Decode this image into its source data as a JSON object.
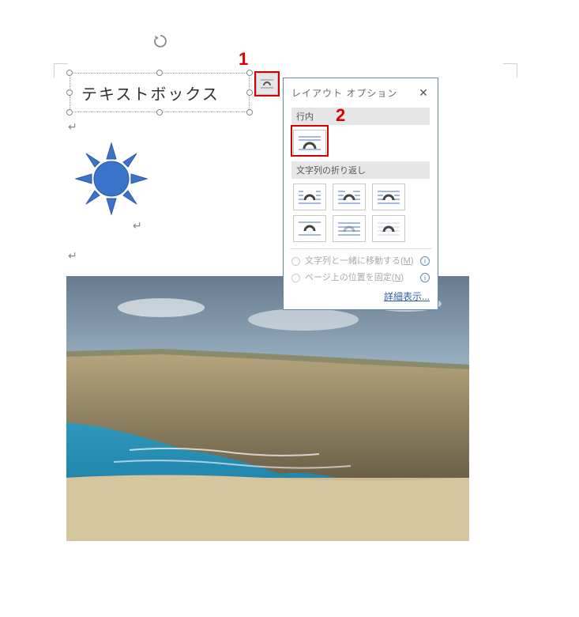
{
  "textbox": {
    "content": "テキストボックス"
  },
  "callouts": {
    "one": "1",
    "two": "2"
  },
  "panel": {
    "title": "レイアウト オプション",
    "close_aria": "閉じる",
    "section_inline": "行内",
    "section_wrap": "文字列の折り返し",
    "radio_move_with_text": "文字列と一緒に移動する(",
    "radio_move_key": "M",
    "radio_move_suffix": ")",
    "radio_fix_position": "ページ上の位置を固定(",
    "radio_fix_key": "N",
    "radio_fix_suffix": ")",
    "details": "詳細表示..."
  },
  "icons": {
    "layout_button": "layout-options",
    "wrap_inline": "in-line-with-text",
    "wrap_square": "square",
    "wrap_tight": "tight",
    "wrap_through": "through",
    "wrap_topbottom": "top-and-bottom",
    "wrap_behind": "behind-text",
    "wrap_front": "in-front-of-text"
  }
}
